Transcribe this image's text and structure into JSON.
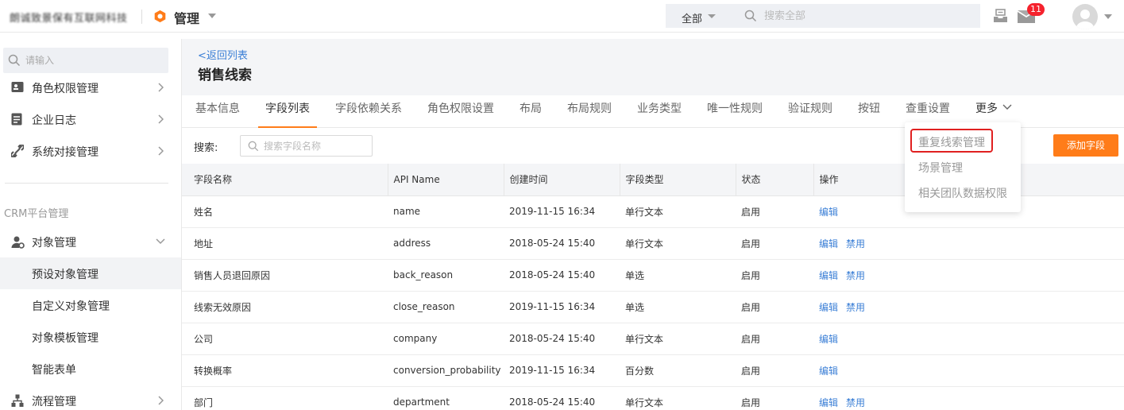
{
  "header": {
    "company_name": "朗诚致景保有互联网科技",
    "app_title": "管理",
    "search_scope": "全部",
    "search_placeholder": "搜索全部",
    "mail_badge": "11"
  },
  "sidebar": {
    "search_placeholder": "请输入",
    "items_top": [
      {
        "label": "角色权限管理",
        "icon": "id-card-icon"
      },
      {
        "label": "企业日志",
        "icon": "document-icon"
      },
      {
        "label": "系统对接管理",
        "icon": "link-icon"
      }
    ],
    "group_label": "CRM平台管理",
    "object_mgmt": "对象管理",
    "sub_items": [
      "预设对象管理",
      "自定义对象管理",
      "对象模板管理",
      "智能表单"
    ],
    "process_mgmt": "流程管理"
  },
  "main": {
    "back_link": "<返回列表",
    "page_title": "销售线索",
    "tabs": [
      "基本信息",
      "字段列表",
      "字段依赖关系",
      "角色权限设置",
      "布局",
      "布局规则",
      "业务类型",
      "唯一性规则",
      "验证规则",
      "按钮",
      "查重设置",
      "更多"
    ],
    "active_tab": "字段列表",
    "search_label": "搜索:",
    "field_search_placeholder": "搜索字段名称",
    "add_button": "添加字段",
    "table": {
      "columns": [
        "字段名称",
        "API Name",
        "创建时间",
        "字段类型",
        "状态",
        "操作"
      ],
      "rows": [
        {
          "name": "姓名",
          "api": "name",
          "created": "2019-11-15 16:34",
          "type": "单行文本",
          "status": "启用",
          "edit": "编辑",
          "disable": ""
        },
        {
          "name": "地址",
          "api": "address",
          "created": "2018-05-24 15:40",
          "type": "单行文本",
          "status": "启用",
          "edit": "编辑",
          "disable": "禁用"
        },
        {
          "name": "销售人员退回原因",
          "api": "back_reason",
          "created": "2018-05-24 15:40",
          "type": "单选",
          "status": "启用",
          "edit": "编辑",
          "disable": "禁用"
        },
        {
          "name": "线索无效原因",
          "api": "close_reason",
          "created": "2019-11-15 16:34",
          "type": "单选",
          "status": "启用",
          "edit": "编辑",
          "disable": "禁用"
        },
        {
          "name": "公司",
          "api": "company",
          "created": "2018-05-24 15:40",
          "type": "单行文本",
          "status": "启用",
          "edit": "编辑",
          "disable": ""
        },
        {
          "name": "转换概率",
          "api": "conversion_probability",
          "created": "2019-11-15 16:34",
          "type": "百分数",
          "status": "启用",
          "edit": "编辑",
          "disable": ""
        },
        {
          "name": "部门",
          "api": "department",
          "created": "2018-05-24 15:40",
          "type": "单行文本",
          "status": "启用",
          "edit": "编辑",
          "disable": "禁用"
        }
      ]
    },
    "more_menu": [
      "重复线索管理",
      "场景管理",
      "相关团队数据权限"
    ]
  },
  "colors": {
    "accent": "#ff7c19",
    "link": "#3b7fd6",
    "highlight": "#e02020",
    "badge": "#f5222d"
  }
}
